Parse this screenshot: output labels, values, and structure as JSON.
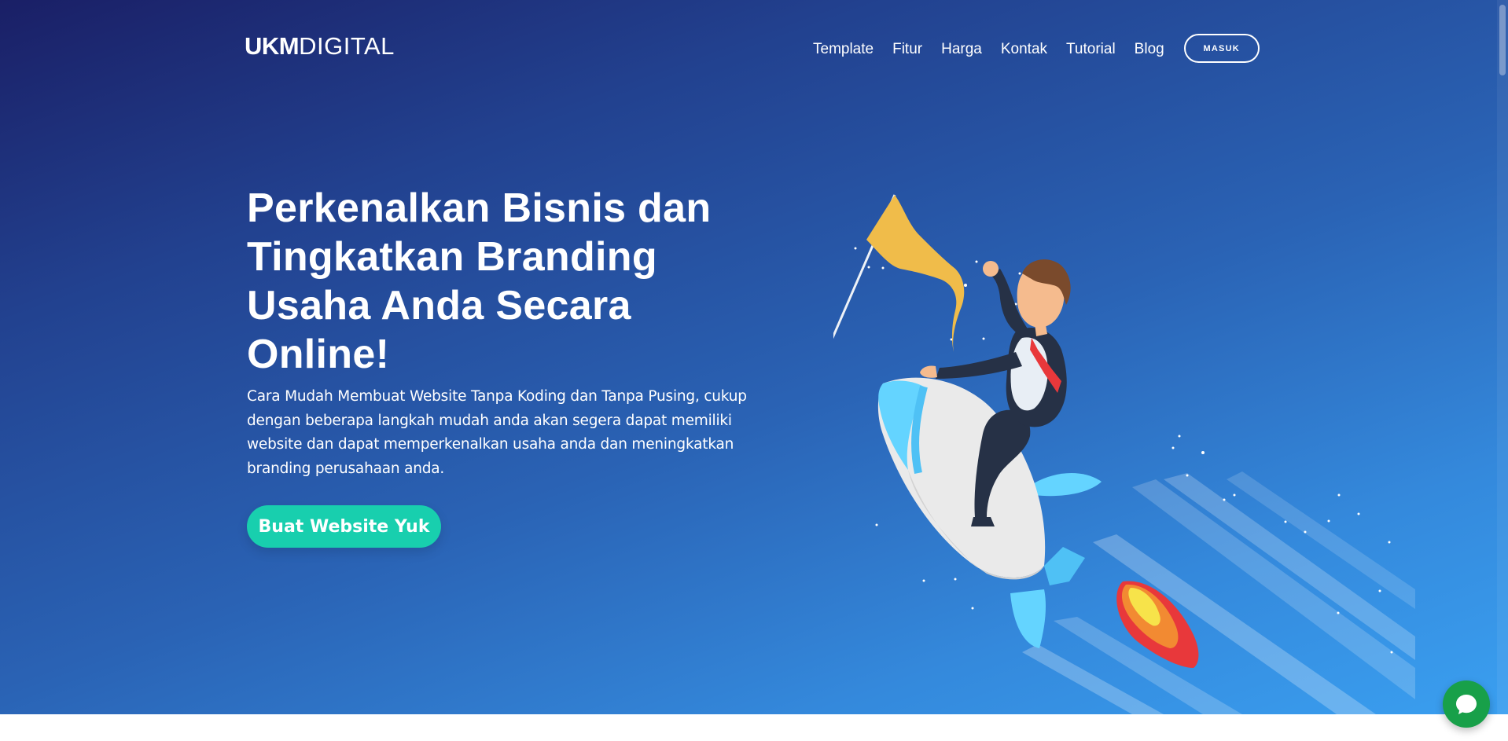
{
  "brand": {
    "logo_bold": "UKM",
    "logo_light": "DIGITAL"
  },
  "nav": {
    "items": [
      "Template",
      "Fitur",
      "Harga",
      "Kontak",
      "Tutorial",
      "Blog"
    ],
    "login_label": "MASUK"
  },
  "hero": {
    "headline": "Perkenalkan Bisnis dan Tingkatkan Branding Usaha Anda Secara Online!",
    "subtext": "Cara Mudah Membuat Website Tanpa Koding dan Tanpa Pusing, cukup dengan beberapa langkah mudah anda akan segera dapat memiliki website dan dapat memperkenalkan usaha anda dan meningkatkan branding perusahaan anda.",
    "cta_label": "Buat Website Yuk",
    "illustration": "businessman-on-rocket-illustration"
  },
  "chat": {
    "icon": "chat-bubble-icon"
  },
  "colors": {
    "gradient_start": "#1a1f66",
    "gradient_end": "#3a9ff0",
    "cta": "#18cfae",
    "chat": "#18a049",
    "flag": "#f0bc4a"
  }
}
